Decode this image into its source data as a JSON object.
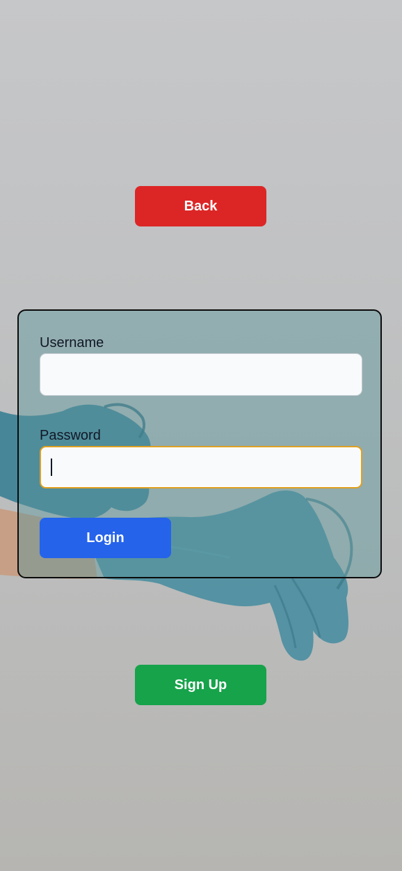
{
  "nav": {
    "back_label": "Back",
    "signup_label": "Sign Up"
  },
  "login_form": {
    "username_label": "Username",
    "username_value": "",
    "password_label": "Password",
    "password_value": "",
    "login_label": "Login"
  },
  "colors": {
    "back": "#dc2626",
    "signup": "#16a34a",
    "login": "#2563eb",
    "focus_ring": "#e0a020"
  },
  "background": {
    "icon": "gloved-hands-photo"
  }
}
